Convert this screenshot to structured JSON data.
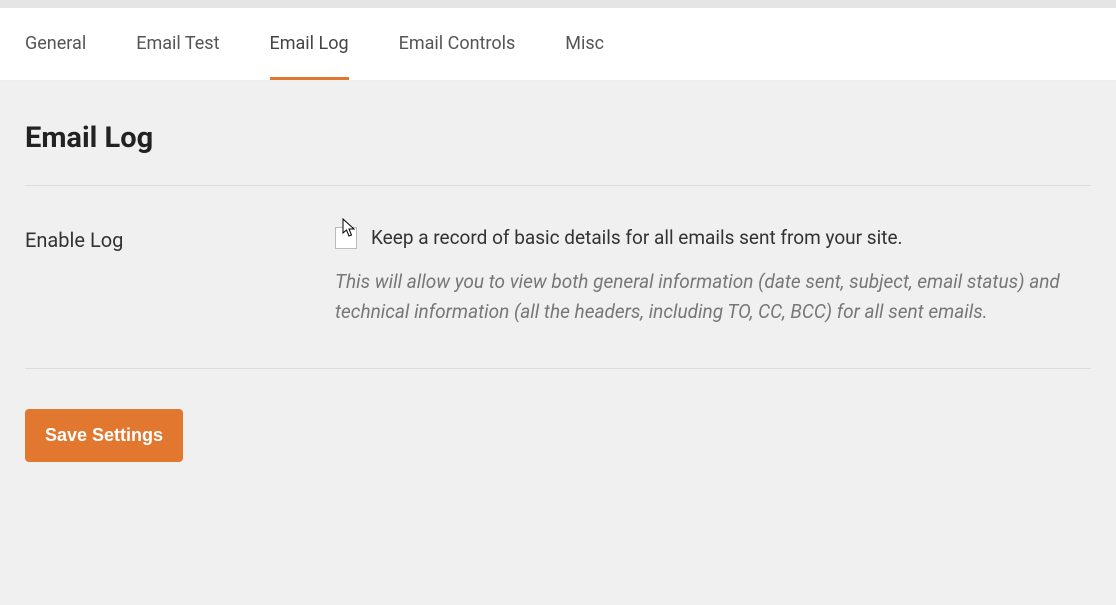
{
  "tabs": [
    {
      "label": "General"
    },
    {
      "label": "Email Test"
    },
    {
      "label": "Email Log",
      "active": true
    },
    {
      "label": "Email Controls"
    },
    {
      "label": "Misc"
    }
  ],
  "page": {
    "title": "Email Log"
  },
  "settings": {
    "enable_log": {
      "label": "Enable Log",
      "checkbox_label": "Keep a record of basic details for all emails sent from your site.",
      "description": "This will allow you to view both general information (date sent, subject, email status) and technical information (all the headers, including TO, CC, BCC) for all sent emails.",
      "checked": false
    }
  },
  "buttons": {
    "save": "Save Settings"
  }
}
